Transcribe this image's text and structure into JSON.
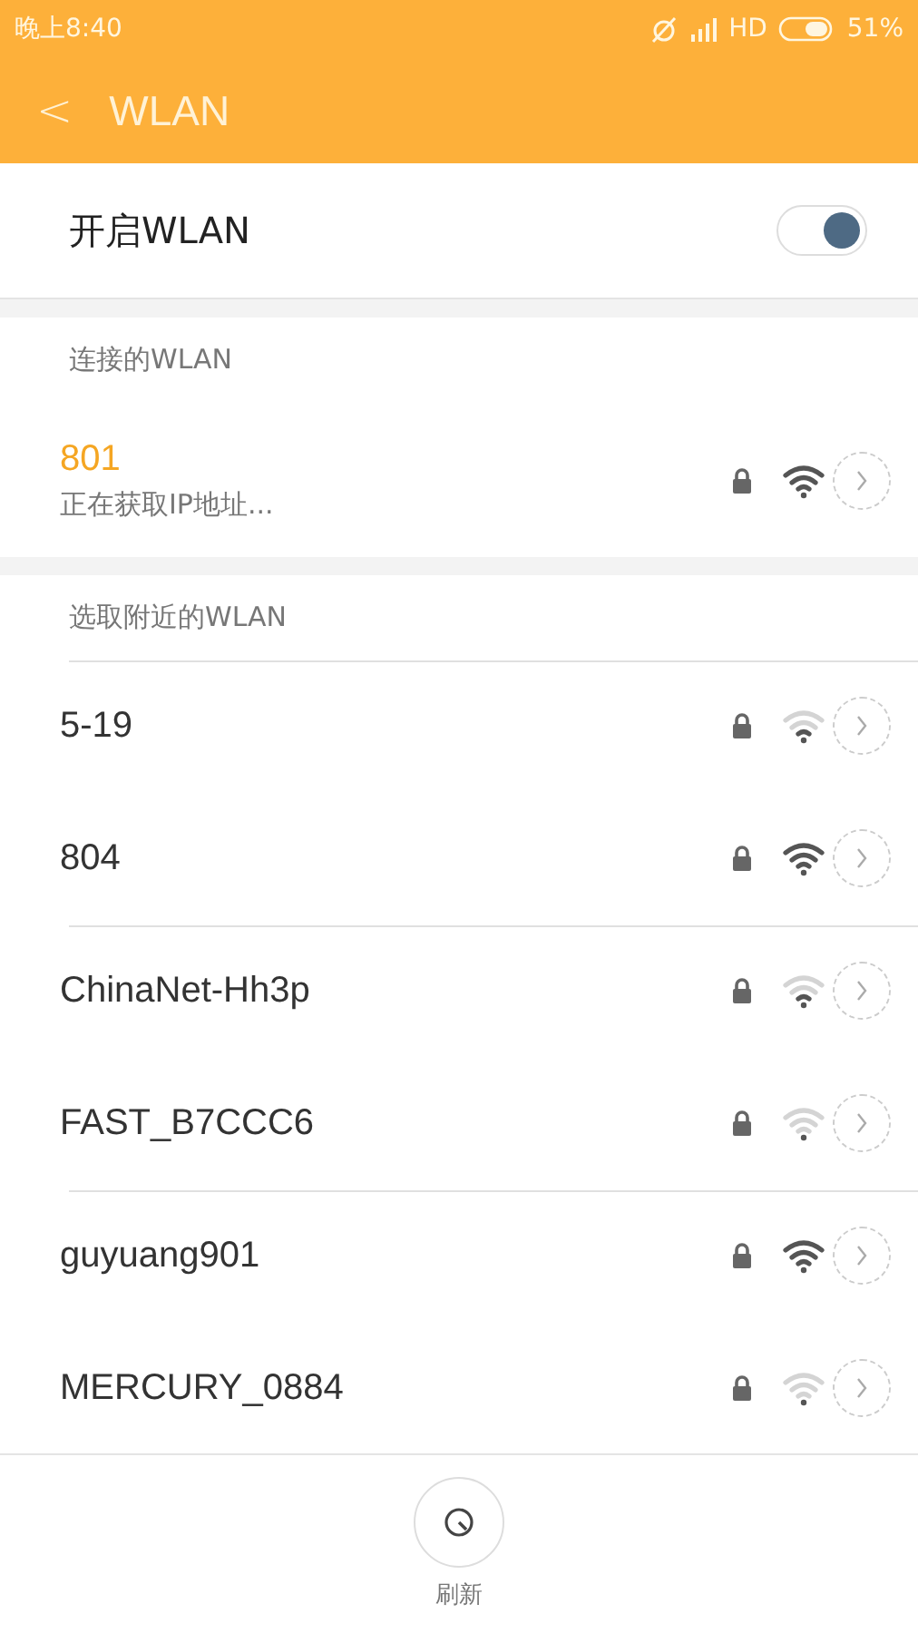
{
  "status_bar": {
    "time": "晚上8:40",
    "network": "HD",
    "battery": "51%"
  },
  "header": {
    "back": "<",
    "title": "WLAN"
  },
  "wlan_toggle": {
    "label": "开启WLAN",
    "on": true
  },
  "connected": {
    "heading": "连接的WLAN",
    "network": {
      "name": "801",
      "status": "正在获取IP地址...",
      "locked": true,
      "full_signal": true,
      "no_signal": false
    }
  },
  "nearby": {
    "heading": "选取附近的WLAN",
    "networks": [
      {
        "name": "5-19",
        "locked": true,
        "full_signal": false,
        "no_signal": false,
        "divider": true
      },
      {
        "name": "804",
        "locked": true,
        "full_signal": true,
        "no_signal": false,
        "divider": false
      },
      {
        "name": "ChinaNet-Hh3p",
        "locked": true,
        "full_signal": false,
        "no_signal": false,
        "divider": true
      },
      {
        "name": "FAST_B7CCC6",
        "locked": true,
        "full_signal": false,
        "no_signal": true,
        "divider": false
      },
      {
        "name": "guyuang901",
        "locked": true,
        "full_signal": true,
        "no_signal": false,
        "divider": true
      },
      {
        "name": "MERCURY_0884",
        "locked": true,
        "full_signal": false,
        "no_signal": true,
        "divider": false
      }
    ]
  },
  "bottom_bar": {
    "refresh_label": "刷新"
  }
}
